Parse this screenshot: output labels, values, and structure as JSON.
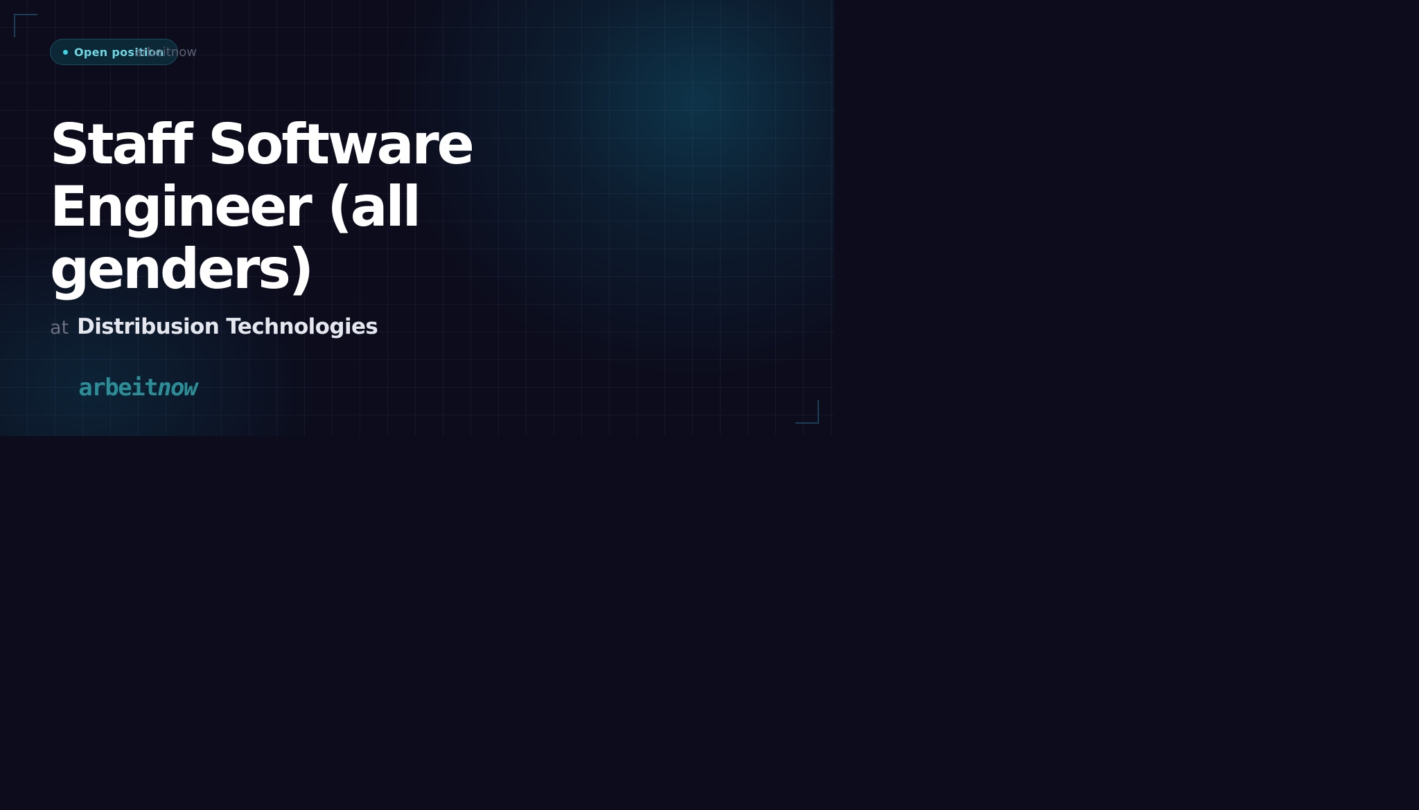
{
  "badge": {
    "label": "Open position"
  },
  "header": {
    "site_label": "arbeitnow"
  },
  "job": {
    "title": "Staff Software Engineer (all genders)",
    "company_prefix": "at",
    "company": "Distribusion Technologies"
  },
  "logo": {
    "text_plain": "arbeit",
    "text_italic": "now"
  },
  "colors": {
    "background": "#0c0c1c",
    "accent": "#3ed3e0",
    "logo": "#2b8d95",
    "title": "#ffffff"
  },
  "icons": {
    "badge_dot": "status-dot-icon"
  }
}
